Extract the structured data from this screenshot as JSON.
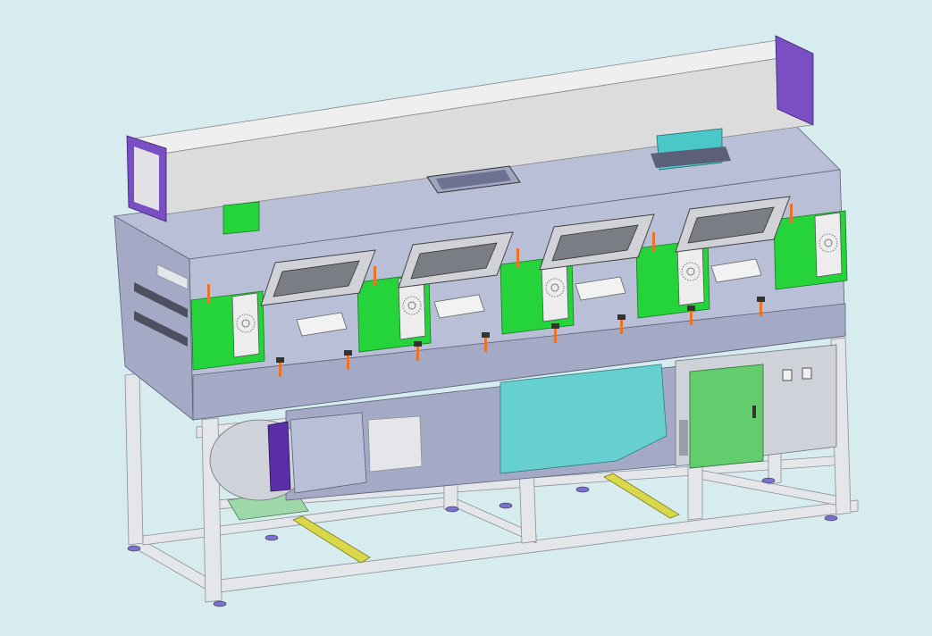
{
  "scene": {
    "subject": "3d-cad-assembly-render",
    "view": "isometric",
    "render_style": "shaded-with-edges"
  },
  "colors": {
    "background": "#d6ecee",
    "enclosure_panel": "#b9bfd6",
    "enclosure_panel_dark": "#a4aac6",
    "frame": "#e4e6ea",
    "frame_edge": "#8b8f99",
    "duct": "#dcdcdc",
    "duct_flange": "#7b4fc4",
    "glove_port_mount": "#25d43a",
    "handle": "#e8742a",
    "cabinet_door": "#63cc6c",
    "cabinet_body": "#cfd2d8",
    "vent_box": "#4ac7c9",
    "teal_panel": "#66cfcf",
    "rail": "#d9d84a",
    "rail_support": "#9fd8a8",
    "window_glass": "#7a7d84",
    "blower_flange": "#5a2ea6"
  },
  "components": {
    "glove_stations": 5,
    "window_hatches": 4,
    "top_duct": 1,
    "electrical_cabinet": 1,
    "support_frame": 1,
    "blower": 1,
    "leveling_feet": 8
  }
}
